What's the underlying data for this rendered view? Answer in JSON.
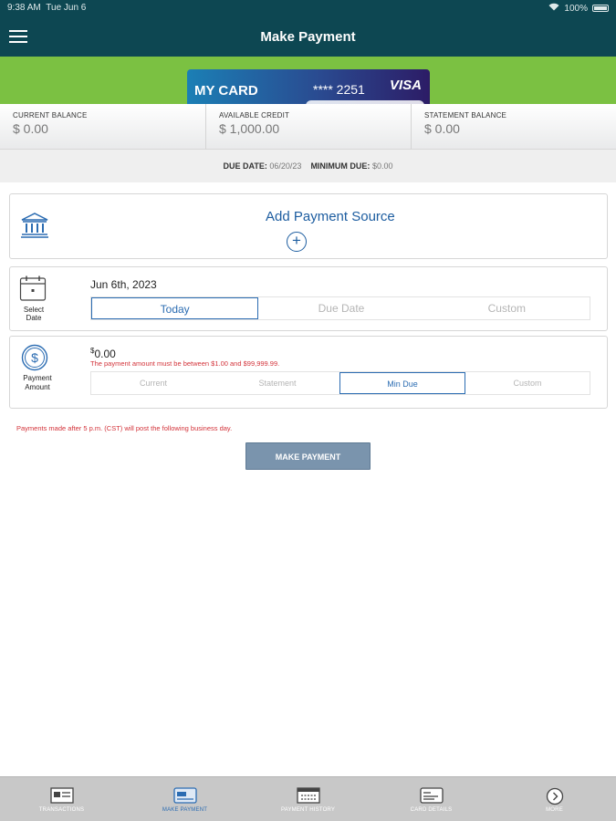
{
  "status_bar": {
    "time": "9:38 AM",
    "date": "Tue Jun 6",
    "battery": "100%"
  },
  "header": {
    "title": "Make Payment"
  },
  "card": {
    "name": "MY CARD",
    "number": "**** 2251",
    "brand": "VISA"
  },
  "balances": [
    {
      "label": "CURRENT BALANCE",
      "value": "$ 0.00"
    },
    {
      "label": "AVAILABLE CREDIT",
      "value": "$ 1,000.00"
    },
    {
      "label": "STATEMENT BALANCE",
      "value": "$ 0.00"
    }
  ],
  "due": {
    "due_label": "DUE DATE:",
    "due_value": "06/20/23",
    "min_label": "MINIMUM DUE:",
    "min_value": "$0.00"
  },
  "payment_source": {
    "label": "Add Payment Source",
    "plus": "+"
  },
  "select_date": {
    "side_label": "Select Date",
    "date": "Jun 6th, 2023",
    "options": [
      "Today",
      "Due Date",
      "Custom"
    ],
    "selected": "Today"
  },
  "payment_amount": {
    "side_label_line1": "Payment",
    "side_label_line2": "Amount",
    "currency": "$",
    "amount": "0.00",
    "error": "The payment amount must be between $1.00 and $99,999.99.",
    "options": [
      "Current",
      "Statement",
      "Min Due",
      "Custom"
    ],
    "selected": "Min Due"
  },
  "notice": "Payments made after 5 p.m. (CST) will post the following business day.",
  "make_payment_button": "MAKE PAYMENT",
  "tabs": [
    {
      "label": "TRANSACTIONS",
      "icon": "transactions-icon"
    },
    {
      "label": "MAKE PAYMENT",
      "icon": "card-payment-icon",
      "active": true
    },
    {
      "label": "PAYMENT HISTORY",
      "icon": "calendar-icon"
    },
    {
      "label": "CARD DETAILS",
      "icon": "card-details-icon"
    },
    {
      "label": "MORE",
      "icon": "chevron-right-circle-icon"
    }
  ],
  "colors": {
    "header": "#0d4752",
    "accent_green": "#7bc142",
    "link_blue": "#2b6cb2",
    "error_red": "#d3333a",
    "button": "#7a94ad"
  }
}
